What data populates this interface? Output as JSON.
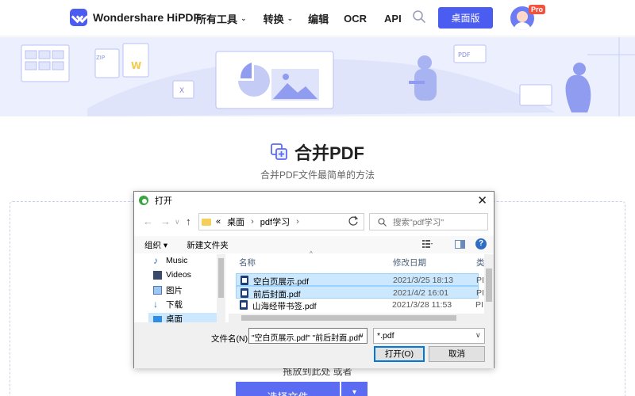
{
  "header": {
    "logo_text": "Wondershare HiPDF",
    "nav": [
      {
        "label": "所有工具",
        "chevron": "⌄"
      },
      {
        "label": "转换",
        "chevron": "⌄"
      },
      {
        "label": "编辑",
        "chevron": ""
      },
      {
        "label": "OCR",
        "chevron": ""
      },
      {
        "label": "API",
        "chevron": ""
      }
    ],
    "desktop_button": "桌面版",
    "pro_badge": "Pro"
  },
  "page": {
    "title": "合并PDF",
    "subtitle": "合并PDF文件最简单的方法",
    "drop_hint": "拖放到此处 或者",
    "select_button": "选择文件",
    "select_dropdown": "▾"
  },
  "dialog": {
    "title": "打开",
    "close": "✕",
    "breadcrumb": {
      "prefix": "«",
      "items": [
        "桌面",
        "pdf学习"
      ],
      "sep": "›"
    },
    "search_placeholder": "搜索\"pdf学习\"",
    "toolbar": {
      "organize": "组织 ▾",
      "new_folder": "新建文件夹",
      "help": "?"
    },
    "left_pane": [
      {
        "label": "Music",
        "icon": "music-icon"
      },
      {
        "label": "Videos",
        "icon": "video-icon"
      },
      {
        "label": "图片",
        "icon": "pictures-icon"
      },
      {
        "label": "下载",
        "icon": "download-icon"
      },
      {
        "label": "桌面",
        "icon": "desktop-icon"
      }
    ],
    "columns": {
      "name": "名称",
      "date": "修改日期",
      "type": "类"
    },
    "files": [
      {
        "name": "空白页展示.pdf",
        "date": "2021/3/25 18:13",
        "type": "PI",
        "selected": true
      },
      {
        "name": "前后封面.pdf",
        "date": "2021/4/2 16:01",
        "type": "PI",
        "selected": true
      },
      {
        "name": "山海经带书签.pdf",
        "date": "2021/3/28 11:53",
        "type": "PI",
        "selected": false
      }
    ],
    "filename_label": "文件名(N):",
    "filename_value": "\"空白页展示.pdf\" \"前后封面.pdf\"",
    "filetype_value": "*.pdf",
    "open_button": "打开(O)",
    "cancel_button": "取消"
  },
  "colors": {
    "accent": "#4b5cf0",
    "selection": "#cce8ff",
    "banner": "#eceffd"
  }
}
